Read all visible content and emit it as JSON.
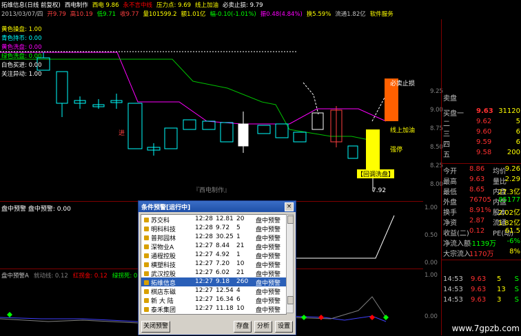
{
  "header": {
    "line1": [
      {
        "text": "拓维信息(日线 前复权)",
        "color": "#ffffff"
      },
      {
        "text": "西电制作",
        "color": "#ffffff"
      },
      {
        "text": "西电 9.86",
        "color": "#ffff00"
      },
      {
        "text": "永不言中线",
        "color": "#ff0000"
      },
      {
        "text": "压力点: 9.69",
        "color": "#ffff00"
      },
      {
        "text": "线上加油",
        "color": "#ffff00"
      },
      {
        "text": "必卖止损: 9.79",
        "color": "#ffffff"
      }
    ],
    "line2": [
      {
        "text": "2013/03/07/四",
        "color": "#c0c0c0"
      },
      {
        "text": "开9.79",
        "color": "#ff4040"
      },
      {
        "text": "高10.19",
        "color": "#ff4040"
      },
      {
        "text": "低9.71",
        "color": "#00ff00"
      },
      {
        "text": "收9.77",
        "color": "#ff4040"
      },
      {
        "text": "量101599.2",
        "color": "#ffff00"
      },
      {
        "text": "额1.01亿",
        "color": "#ffff00"
      },
      {
        "text": "幅-0.10(-1.01%)",
        "color": "#00ff00"
      },
      {
        "text": "振0.48(4.84%)",
        "color": "#ff00ff"
      },
      {
        "text": "换5.59%",
        "color": "#ffff00"
      },
      {
        "text": "流通1.82亿",
        "color": "#c0c0c0"
      },
      {
        "text": "软件服务",
        "color": "#ffff00"
      }
    ]
  },
  "legend_left": [
    {
      "text": "黄色操盘: 1.00",
      "color": "#ffff00"
    },
    {
      "text": "青色持币: 0.00",
      "color": "#00ffff"
    },
    {
      "text": "黄色洗盘: 0.00",
      "color": "#ff00ff"
    },
    {
      "text": "绿色洗盘: 0.00",
      "color": "#00ff00"
    },
    {
      "text": "白色买进: 0.00",
      "color": "#ffffff"
    },
    {
      "text": "关注异动: 1.00",
      "color": "#ffffff"
    }
  ],
  "chart_labels": {
    "sell_stop": "必卖止损",
    "line_up": "线上加油",
    "strong": "强停",
    "wash": "【回调洗盘】",
    "low": "7.92",
    "made_by": "『西电制作』",
    "jin": "进"
  },
  "price_axis": [
    "9.25",
    "9.00",
    "8.75",
    "8.50",
    "8.25",
    "8.00"
  ],
  "sub_panel": {
    "title": "盘中预警 盘中预警: 0.00",
    "scale": [
      "1.00",
      "0.50",
      "0.00"
    ]
  },
  "bottom_panel": {
    "items": [
      {
        "text": "盘中预警A",
        "color": "#c0c0c0"
      },
      {
        "text": "就动线: 0.12",
        "color": "#808080"
      },
      {
        "text": "红拐金: 0.12",
        "color": "#ff0000"
      },
      {
        "text": "绿拐死: 0.12",
        "color": "#00ff00"
      },
      {
        "text": "盘中预警: 0.12",
        "color": "#00ffff"
      }
    ],
    "scale": [
      "1.00",
      "0.00"
    ]
  },
  "right_panel": {
    "asks": [
      {
        "label": "卖盘",
        "price": "",
        "vol": ""
      }
    ],
    "bids": [
      {
        "label": "买盘一",
        "price": "9.63",
        "vol": "31120"
      },
      {
        "label": "二",
        "price": "9.62",
        "vol": "5"
      },
      {
        "label": "三",
        "price": "9.60",
        "vol": "6"
      },
      {
        "label": "四",
        "price": "9.59",
        "vol": "6"
      },
      {
        "label": "五",
        "price": "9.58",
        "vol": "200"
      }
    ],
    "stats": [
      {
        "k1": "今开",
        "v1": "8.86",
        "k2": "均价",
        "v2": "9.26"
      },
      {
        "k1": "最高",
        "v1": "9.63",
        "k2": "量比",
        "v2": "2.29"
      },
      {
        "k1": "最低",
        "v1": "8.65",
        "k2": "内盘",
        "v2": "27.3亿"
      },
      {
        "k1": "外盘",
        "v1": "76705",
        "k2": "内盘",
        "v2": "85177"
      },
      {
        "k1": "换手",
        "v1": "8.91%",
        "k2": "股本",
        "v2": "2.02亿"
      },
      {
        "k1": "净资",
        "v1": "2.87",
        "k2": "流通",
        "v2": "1.82亿"
      },
      {
        "k1": "收益(二)",
        "v1": "0.12",
        "k2": "PE(动)",
        "v2": "61.5"
      },
      {
        "k1": "净流入额",
        "v1": "-1139万",
        "k2": "",
        "v2": "-6%"
      },
      {
        "k1": "大宗流入",
        "v1": "1170万",
        "k2": "",
        "v2": "8%"
      }
    ],
    "ticks": [
      {
        "time": "14:53",
        "price": "9.63",
        "vol": "5",
        "side": "S"
      },
      {
        "time": "14:53",
        "price": "9.63",
        "vol": "13",
        "side": "S"
      },
      {
        "time": "14:53",
        "price": "9.63",
        "vol": "3",
        "side": "S"
      }
    ]
  },
  "dialog": {
    "title": "条件预警[运行中]",
    "close": "×",
    "rows": [
      {
        "name": "苏交科",
        "time": "12:28",
        "price": "12.81",
        "num": "20",
        "type": "盘中预警"
      },
      {
        "name": "明科科技",
        "time": "12:28",
        "price": "9.72",
        "num": "5",
        "type": "盘中预警"
      },
      {
        "name": "普邦园林",
        "time": "12:28",
        "price": "30.25",
        "num": "1",
        "type": "盘中预警"
      },
      {
        "name": "深物业A",
        "time": "12:27",
        "price": "8.44",
        "num": "21",
        "type": "盘中预警"
      },
      {
        "name": "通程控股",
        "time": "12:27",
        "price": "4.92",
        "num": "1",
        "type": "盘中预警"
      },
      {
        "name": "横塑科技",
        "time": "12:27",
        "price": "7.20",
        "num": "10",
        "type": "盘中预警"
      },
      {
        "name": "武汉控股",
        "time": "12:27",
        "price": "6.02",
        "num": "21",
        "type": "盘中预警"
      },
      {
        "name": "拓维信息",
        "time": "12:27",
        "price": "9.18",
        "num": "260",
        "type": "盘中预警"
      },
      {
        "name": "棋店东磁",
        "time": "12:27",
        "price": "12.54",
        "num": "4",
        "type": "盘中预警"
      },
      {
        "name": "新 大 陆",
        "time": "12:27",
        "price": "16.34",
        "num": "6",
        "type": "盘中预警"
      },
      {
        "name": "泰禾集团",
        "time": "12:27",
        "price": "11.18",
        "num": "10",
        "type": "盘中预警"
      }
    ],
    "selected_index": 7,
    "btn_close": "关闭预警",
    "btn_save": "存盘",
    "btn_analyze": "分析",
    "btn_settings": "设置"
  },
  "watermark": "www.7gpzb.com"
}
